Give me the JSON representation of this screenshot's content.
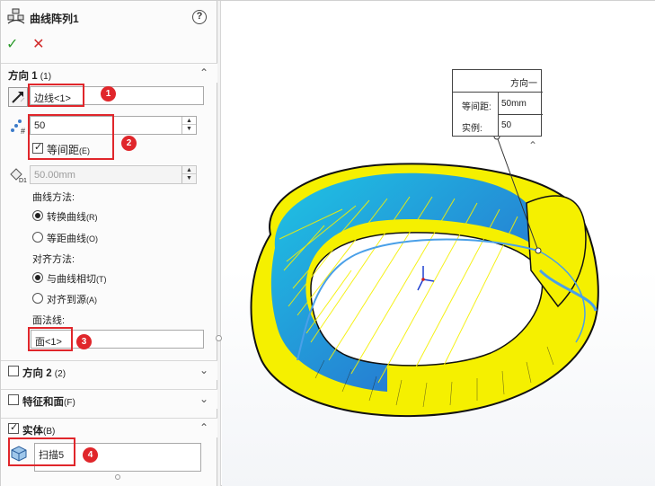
{
  "header": {
    "title": "曲线阵列1",
    "help": "?"
  },
  "actions": {
    "ok": "✓",
    "cancel": "✕"
  },
  "direction1": {
    "label": "方向 1",
    "suffix": "(1)",
    "edge_value": "边线<1>",
    "count_value": "50",
    "equal_spacing_label": "等间距",
    "equal_spacing_hotkey": "(E)",
    "spacing_value": "50.00mm",
    "curve_method_label": "曲线方法:",
    "curve_options": [
      {
        "label": "转换曲线",
        "hotkey": "(R)",
        "selected": true
      },
      {
        "label": "等距曲线",
        "hotkey": "(O)",
        "selected": false
      }
    ],
    "align_method_label": "对齐方法:",
    "align_options": [
      {
        "label": "与曲线相切",
        "hotkey": "(T)",
        "selected": true
      },
      {
        "label": "对齐到源",
        "hotkey": "(A)",
        "selected": false
      }
    ],
    "face_normal_label": "面法线:",
    "face_value": "面<1>"
  },
  "direction2": {
    "label": "方向 2",
    "suffix": "(2)"
  },
  "features_faces": {
    "label": "特征和面",
    "suffix": "(F)"
  },
  "bodies": {
    "label": "实体",
    "suffix": "(B)",
    "body_value": "扫描5"
  },
  "markers": [
    "1",
    "2",
    "3",
    "4"
  ],
  "callout": {
    "title": "方向一",
    "spacing_label": "等间距:",
    "spacing_value": "50mm",
    "instances_label": "实例:",
    "instances_value": "50"
  },
  "colors": {
    "accent_red": "#e0262b",
    "model_yellow": "#f5f000",
    "model_blue": "#1e90e8"
  }
}
